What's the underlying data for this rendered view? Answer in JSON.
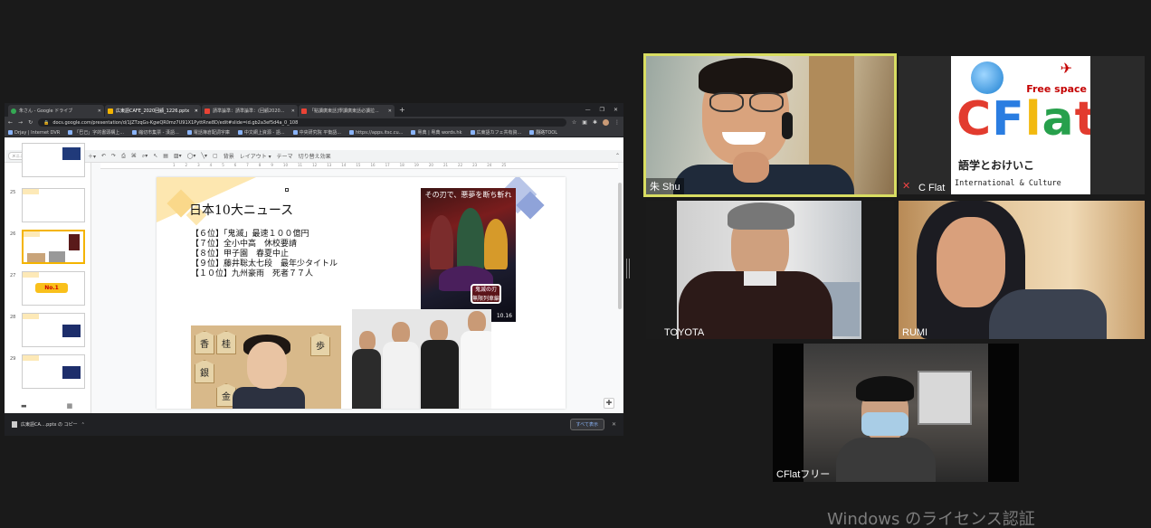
{
  "browser": {
    "tabs": [
      {
        "label": "朱さん - Google ドライブ",
        "color": "#34a853"
      },
      {
        "label": "広東語CAFE_2020回顧_1226.pptx",
        "color": "#f4b400"
      },
      {
        "label": "請準論準：請準論準：(回顧2020...",
        "color": "#ea4335"
      },
      {
        "label": "「點讀廣東話]學讀廣東話必讀拉...",
        "color": "#ea4335"
      }
    ],
    "new_tab": "+",
    "url": "docs.google.com/presentation/d/1JZTzqGs-KgwQR0mz7U91X1PyttRne8D/edit#slide=id.gb2a3ef5d4a_0_108",
    "bookmarks": [
      "Drjay | Internet DVR",
      "「巴己」字的書頭構上...",
      "縮切市集票 - 漢語...",
      "電話簿倉配詞字庫",
      "中文網上資源 - 語...",
      "中央研究院 平衡語...",
      "https://apps.itsc.cu...",
      "粵典 | 粵典 words.hk",
      "広東語カフェ共有資...",
      "翻路TOOL"
    ],
    "menu_search_placeholder": "メニューを検索 (Alt+/)",
    "toolbar": {
      "bg": "背景",
      "layout": "レイアウト ▾",
      "theme": "テーマ",
      "transition": "切り替え効果"
    },
    "ruler_marks": [
      "1",
      "2",
      "3",
      "4",
      "5",
      "6",
      "7",
      "8",
      "9",
      "10",
      "11",
      "12",
      "13",
      "14",
      "15",
      "16",
      "17",
      "18",
      "19",
      "20",
      "21",
      "22",
      "23",
      "24",
      "25"
    ],
    "thumbnails": [
      {
        "num": "",
        "kind": "photo"
      },
      {
        "num": "25",
        "kind": "text"
      },
      {
        "num": "26",
        "kind": "current"
      },
      {
        "num": "27",
        "kind": "no1",
        "badge": "No.1"
      },
      {
        "num": "28",
        "kind": "photo"
      },
      {
        "num": "29",
        "kind": "photo"
      }
    ],
    "download": {
      "file": "広東語CA....pptx の コピー",
      "show_all": "すべて表示",
      "close": "✕"
    }
  },
  "slide": {
    "title": "日本10大ニュース",
    "items": [
      "【６位】「鬼滅」最速１００億円",
      "【７位】全小中高　休校要請",
      "【８位】甲子園　春夏中止",
      "【９位】藤井聡太七段　最年少タイトル",
      "【１０位】九州豪雨　死者７７人"
    ],
    "poster_caption": "その刃で、悪夢を断ち斬れ",
    "poster_logo": "鬼滅の刃 無限列車編",
    "poster_footer": "10.16",
    "shogi_pieces": [
      "香",
      "桂",
      "銀",
      "金",
      "歩"
    ]
  },
  "participants": [
    {
      "name": "朱 Shu",
      "speaking": true
    },
    {
      "name": "C Flat",
      "muted": true
    },
    {
      "name": "TOYOTA"
    },
    {
      "name": "RUMI"
    },
    {
      "name": "CFlatフリー"
    }
  ],
  "cflat_logo": {
    "free_space": "Free space",
    "letters": [
      {
        "ch": "C",
        "color": "#e23b2e"
      },
      {
        "ch": "F",
        "color": "#2a7de1"
      },
      {
        "ch": "l",
        "color": "#f2b90f"
      },
      {
        "ch": "a",
        "color": "#27a04c"
      },
      {
        "ch": "t",
        "color": "#e23b2e"
      }
    ],
    "tagline_jp": "語学とおけいこ",
    "tagline_en": "International & Culture"
  },
  "watermark": "Windows のライセンス認証"
}
